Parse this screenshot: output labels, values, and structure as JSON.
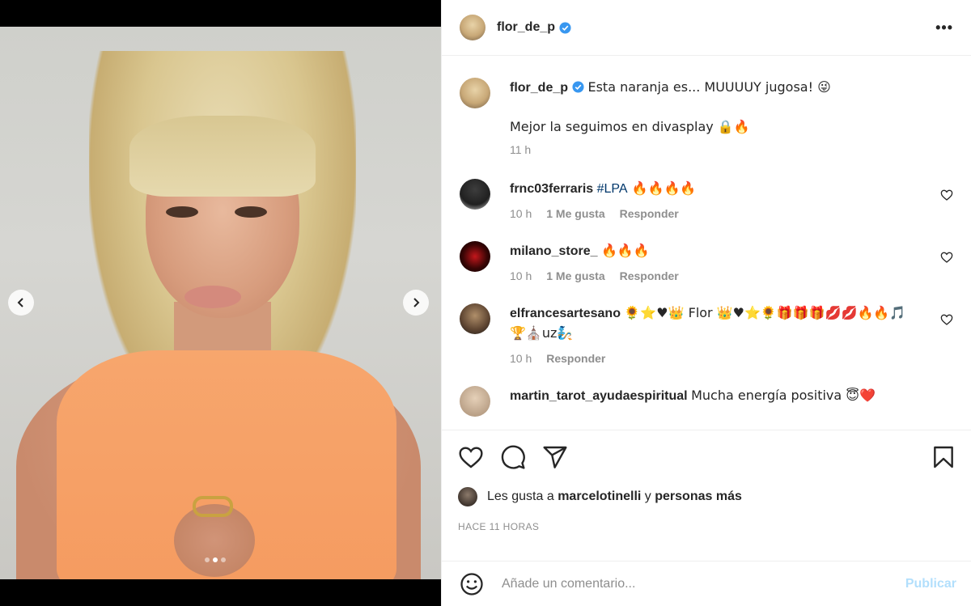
{
  "post": {
    "username": "flor_de_p",
    "caption": "Esta naranja es... MUUUUY jugosa! 😜",
    "caption2": "Mejor la seguimos en divasplay 🔒🔥",
    "caption_time": "11 h"
  },
  "comments": [
    {
      "user": "frnc03ferraris",
      "tag": "#LPA",
      "text": " 🔥🔥🔥🔥",
      "time": "10 h",
      "likes": "1 Me gusta",
      "reply": "Responder"
    },
    {
      "user": "milano_store_",
      "text": "🔥🔥🔥",
      "time": "10 h",
      "likes": "1 Me gusta",
      "reply": "Responder"
    },
    {
      "user": "elfrancesartesano",
      "text": "🌻⭐♥👑 Flor 👑♥⭐🌻🎁🎁🎁💋💋🔥🔥🎵🏆⛪uz🧞",
      "time": "10 h",
      "reply": "Responder"
    },
    {
      "user": "martin_tarot_ayudaespiritual",
      "text": "Mucha energía positiva 😇❤️"
    }
  ],
  "likes": {
    "prefix": "Les gusta a",
    "user": "marcelotinelli",
    "conj": "y",
    "rest": "personas más"
  },
  "timestamp": "HACE 11 HORAS",
  "add_comment": {
    "placeholder": "Añade un comentario...",
    "publish": "Publicar"
  },
  "colors": {
    "verified": "#3897f0",
    "link": "#00376b",
    "secondary": "#8e8e8e",
    "publish_disabled": "#b2dffc",
    "swimsuit": "#f59b60"
  },
  "carousel": {
    "total": 3,
    "current": 2
  }
}
